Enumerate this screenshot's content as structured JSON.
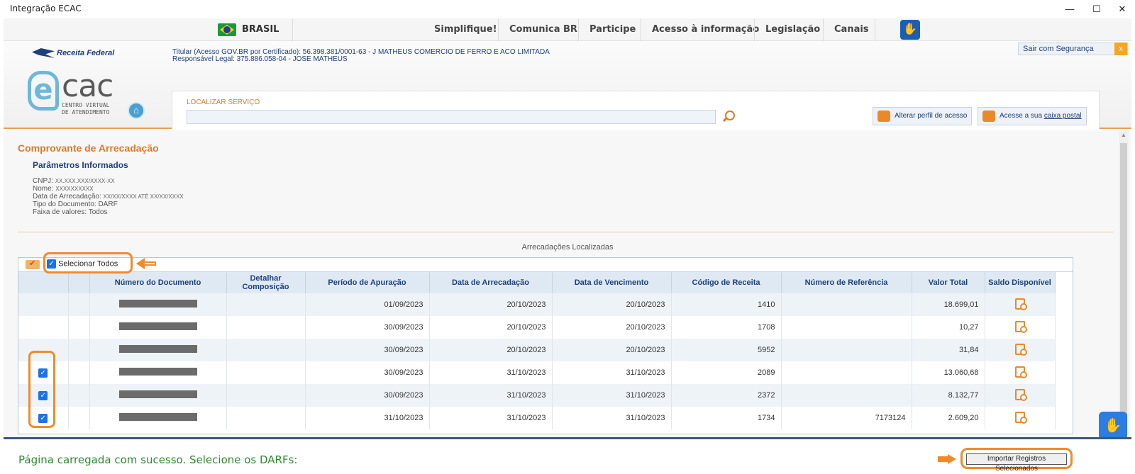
{
  "window": {
    "title": "Integração ECAC",
    "controls": {
      "minimize": "—",
      "maximize": "☐",
      "close": "✕"
    }
  },
  "govbar": {
    "brasil": "BRASIL",
    "links": [
      "Simplifique!",
      "Comunica BR",
      "Participe",
      "Acesso à informação",
      "Legislação",
      "Canais"
    ]
  },
  "header": {
    "logo_text": "Receita Federal",
    "ecac_e": "e",
    "ecac_cac": "cac",
    "ecac_sub1": "CENTRO VIRTUAL",
    "ecac_sub2": "DE ATENDIMENTO",
    "titular": "Titular (Acesso GOV.BR por Certificado): 56.398.381/0001-63 - J MATHEUS COMERCIO DE FERRO E ACO LIMITADA",
    "responsavel": "Responsável Legal: 375.886.058-04 - JOSE MATHEUS",
    "sair": "Sair com Segurança",
    "sair_x": "x",
    "search_label": "LOCALIZAR SERVIÇO",
    "alterar_perfil": "Alterar perfil de acesso",
    "caixa_prefix": "Acesse a sua ",
    "caixa_link": "caixa postal"
  },
  "page": {
    "title": "Comprovante de Arrecadação",
    "params_title": "Parâmetros Informados",
    "cnpj_label": "CNPJ:",
    "cnpj_value": "XX.XXX.XXX/XXXX-XX",
    "nome_label": "Nome:",
    "nome_value": "XXXXXXXXXX",
    "data_label": "Data de Arrecadação:",
    "data_value": "XX/XX/XXXX ATÉ XX/XX/XXXX",
    "tipo": "Tipo do Documento: DARF",
    "faixa": "Faixa de valores: Todos",
    "table_title": "Arrecadações Localizadas",
    "select_all": "Selecionar Todos"
  },
  "table": {
    "headers": [
      "",
      "",
      "Número do Documento",
      "Detalhar Composição",
      "Período de Apuração",
      "Data de Arrecadação",
      "Data de Vencimento",
      "Código de Receita",
      "Número de Referência",
      "Valor Total",
      "Saldo Disponível"
    ],
    "rows": [
      {
        "checked": false,
        "periodo": "01/09/2023",
        "arrecadacao": "20/10/2023",
        "vencimento": "20/10/2023",
        "codigo": "1410",
        "referencia": "",
        "valor": "18.699,01"
      },
      {
        "checked": false,
        "periodo": "30/09/2023",
        "arrecadacao": "20/10/2023",
        "vencimento": "20/10/2023",
        "codigo": "1708",
        "referencia": "",
        "valor": "10,27"
      },
      {
        "checked": false,
        "periodo": "30/09/2023",
        "arrecadacao": "20/10/2023",
        "vencimento": "20/10/2023",
        "codigo": "5952",
        "referencia": "",
        "valor": "31,84"
      },
      {
        "checked": true,
        "periodo": "30/09/2023",
        "arrecadacao": "31/10/2023",
        "vencimento": "31/10/2023",
        "codigo": "2089",
        "referencia": "",
        "valor": "13.060,68"
      },
      {
        "checked": true,
        "periodo": "30/09/2023",
        "arrecadacao": "31/10/2023",
        "vencimento": "31/10/2023",
        "codigo": "2372",
        "referencia": "",
        "valor": "8.132,77"
      },
      {
        "checked": true,
        "periodo": "31/10/2023",
        "arrecadacao": "31/10/2023",
        "vencimento": "31/10/2023",
        "codigo": "1734",
        "referencia": "7173124",
        "valor": "2.609,20"
      }
    ]
  },
  "footer": {
    "status": "Página carregada com sucesso. Selecione os DARFs:",
    "import_button": "Importar Registros Selecionados"
  },
  "colors": {
    "accent": "#e07a2a",
    "navy": "#1d3f7a",
    "annotation": "#f28a2b",
    "status_green": "#2e8b2e"
  }
}
